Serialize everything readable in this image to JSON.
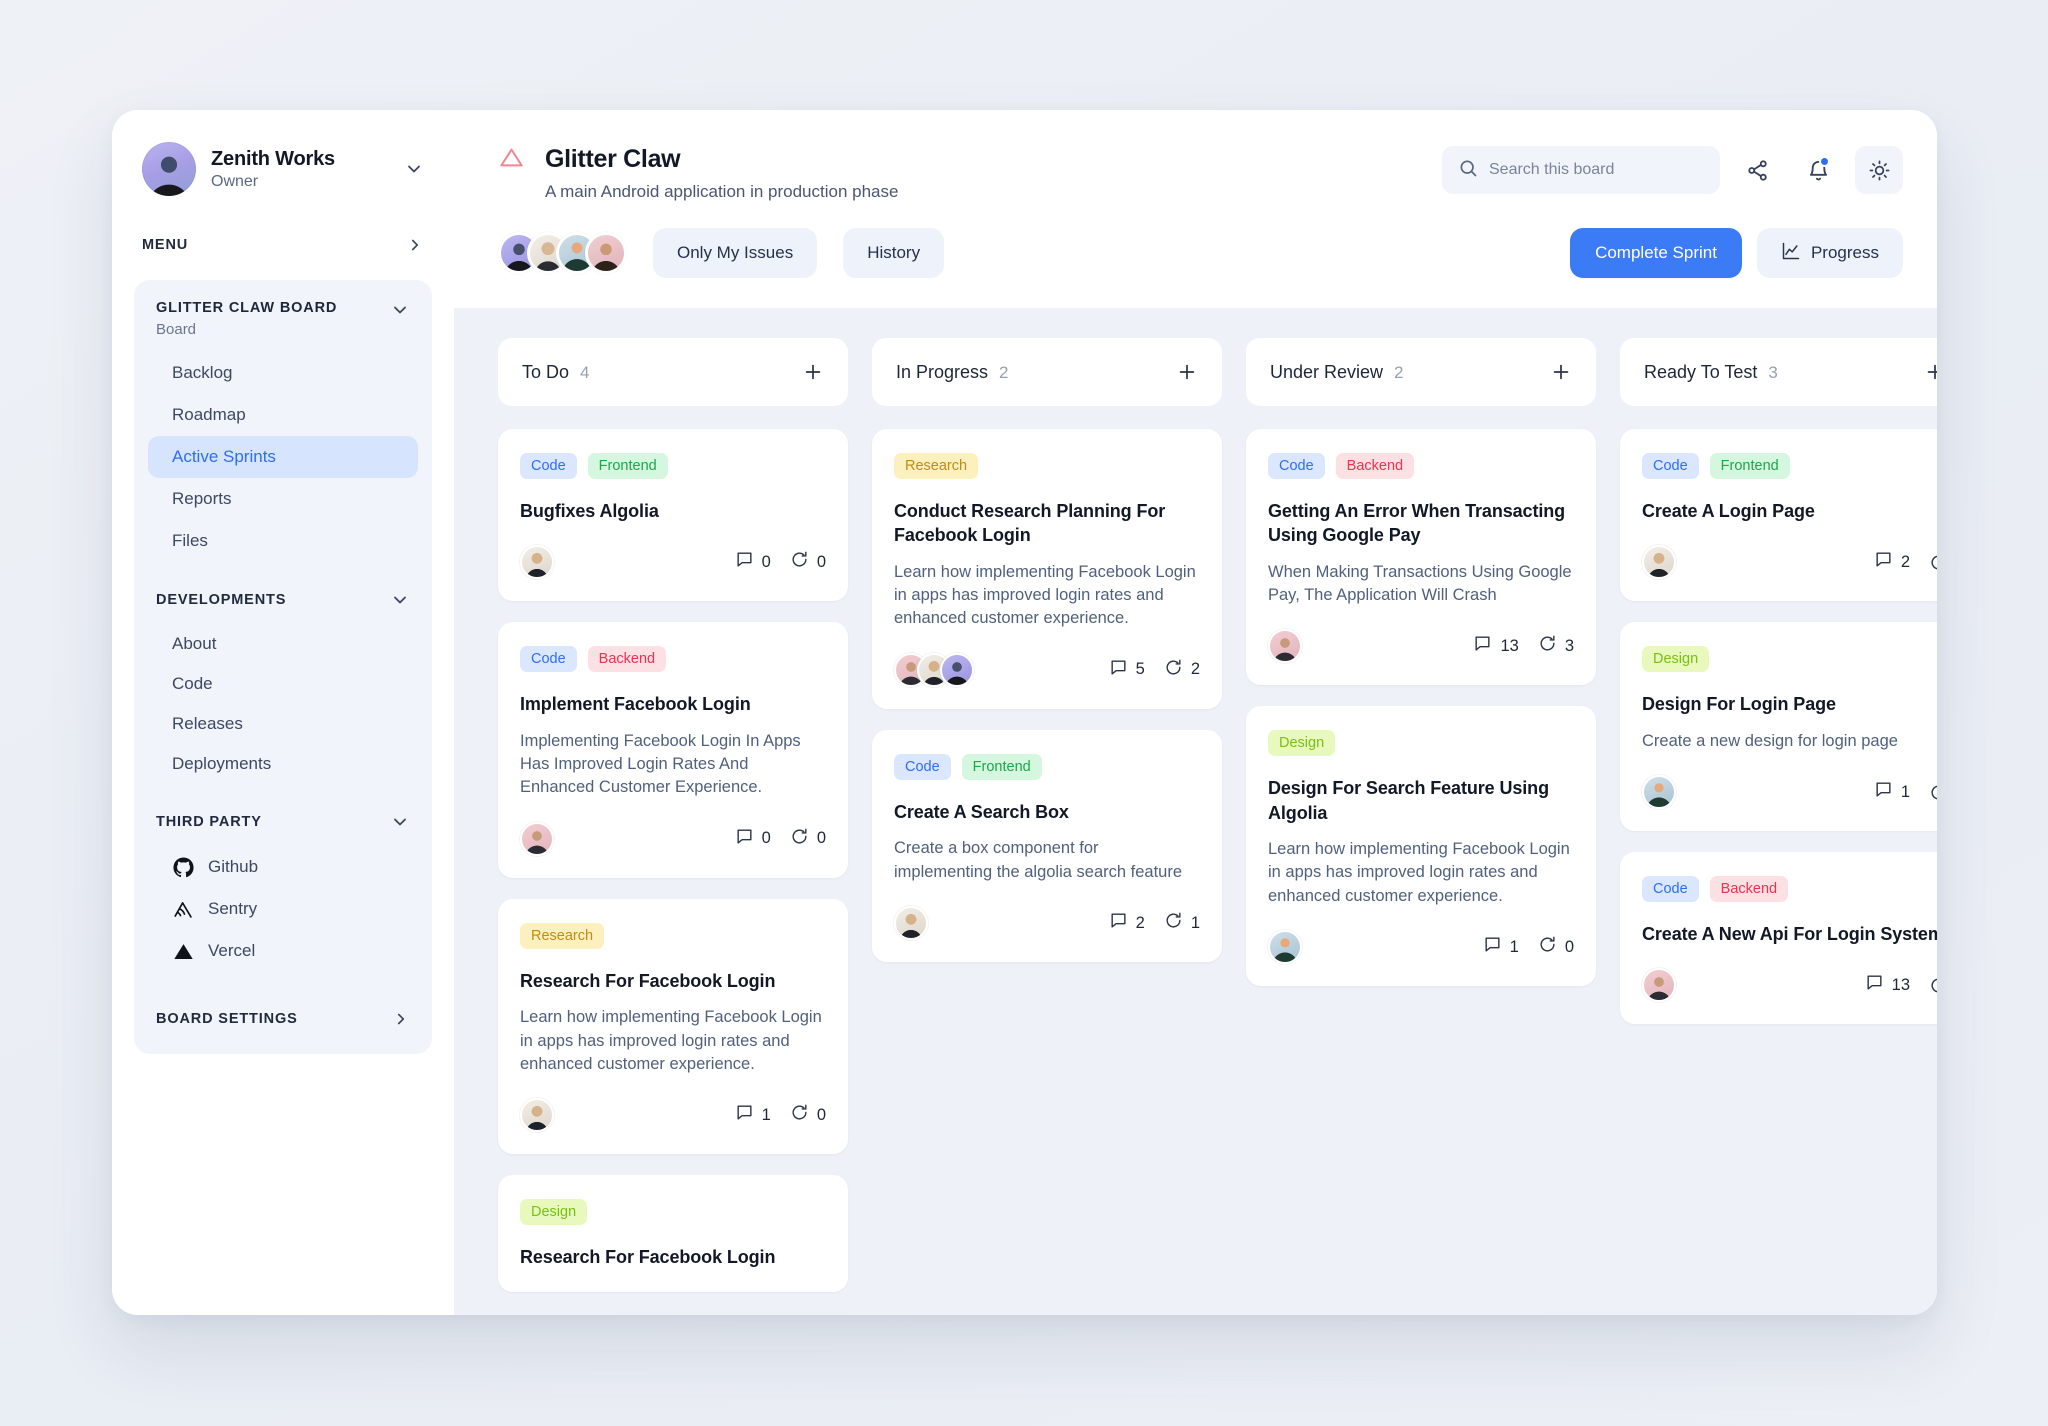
{
  "sidebar": {
    "org": {
      "name": "Zenith Works",
      "role": "Owner"
    },
    "menu_label": "MENU",
    "board": {
      "title": "GLITTER CLAW BOARD",
      "subtitle": "Board",
      "items": [
        {
          "label": "Backlog",
          "active": false
        },
        {
          "label": "Roadmap",
          "active": false
        },
        {
          "label": "Active Sprints",
          "active": true
        },
        {
          "label": "Reports",
          "active": false
        },
        {
          "label": "Files",
          "active": false
        }
      ]
    },
    "developments": {
      "title": "DEVELOPMENTS",
      "items": [
        {
          "label": "About"
        },
        {
          "label": "Code"
        },
        {
          "label": "Releases"
        },
        {
          "label": "Deployments"
        }
      ]
    },
    "third_party": {
      "title": "THIRD PARTY",
      "items": [
        {
          "label": "Github",
          "icon": "github-icon"
        },
        {
          "label": "Sentry",
          "icon": "sentry-icon"
        },
        {
          "label": "Vercel",
          "icon": "vercel-icon"
        }
      ]
    },
    "board_settings_label": "BOARD SETTINGS"
  },
  "header": {
    "project_name": "Glitter Claw",
    "project_desc": "A main Android application in production phase",
    "search_placeholder": "Search this board",
    "search_value": "",
    "icons": {
      "share": "share-icon",
      "notifications": "bell-icon",
      "theme": "sun-icon"
    }
  },
  "toolbar": {
    "only_my_issues": "Only My Issues",
    "history": "History",
    "complete_sprint": "Complete Sprint",
    "progress": "Progress"
  },
  "colors": {
    "accent": "#3b7bf5",
    "tag_code": "#2f6ef0",
    "tag_frontend": "#1aa84a",
    "tag_backend": "#f1304f",
    "tag_research": "#c08c12",
    "tag_design": "#76c214"
  },
  "board": {
    "columns": [
      {
        "title": "To Do",
        "count": "4",
        "cards": [
          {
            "tags": [
              {
                "label": "Code",
                "cls": "t-code"
              },
              {
                "label": "Frontend",
                "cls": "t-frontend"
              }
            ],
            "title": "Bugfixes Algolia",
            "desc": "",
            "avatars": [
              "fa1"
            ],
            "comments": "0",
            "updates": "0"
          },
          {
            "tags": [
              {
                "label": "Code",
                "cls": "t-code"
              },
              {
                "label": "Backend",
                "cls": "t-backend"
              }
            ],
            "title": "Implement Facebook Login",
            "desc": "Implementing Facebook Login In Apps Has Improved Login Rates And Enhanced Customer Experience.",
            "avatars": [
              "fa2"
            ],
            "comments": "0",
            "updates": "0"
          },
          {
            "tags": [
              {
                "label": "Research",
                "cls": "t-research"
              }
            ],
            "title": "Research For Facebook Login",
            "desc": "Learn how implementing Facebook Login in apps has improved login rates and enhanced customer experience.",
            "avatars": [
              "fa1"
            ],
            "comments": "1",
            "updates": "0"
          },
          {
            "tags": [
              {
                "label": "Design",
                "cls": "t-design"
              }
            ],
            "title": "Research For Facebook Login",
            "desc": "",
            "avatars": [],
            "comments": "",
            "updates": ""
          }
        ]
      },
      {
        "title": "In Progress",
        "count": "2",
        "cards": [
          {
            "tags": [
              {
                "label": "Research",
                "cls": "t-research"
              }
            ],
            "title": "Conduct Research Planning For Facebook Login",
            "desc": "Learn how implementing Facebook Login in apps has improved login rates and enhanced customer experience.",
            "avatars": [
              "fa2",
              "fa1",
              "fa4"
            ],
            "comments": "5",
            "updates": "2"
          },
          {
            "tags": [
              {
                "label": "Code",
                "cls": "t-code"
              },
              {
                "label": "Frontend",
                "cls": "t-frontend"
              }
            ],
            "title": "Create A Search Box",
            "desc": "Create a box component for implementing the algolia search feature",
            "avatars": [
              "fa1"
            ],
            "comments": "2",
            "updates": "1"
          }
        ]
      },
      {
        "title": "Under Review",
        "count": "2",
        "cards": [
          {
            "tags": [
              {
                "label": "Code",
                "cls": "t-code"
              },
              {
                "label": "Backend",
                "cls": "t-backend"
              }
            ],
            "title": "Getting An Error When Transacting Using Google Pay",
            "desc": "When Making Transactions Using Google Pay, The Application Will Crash",
            "avatars": [
              "fa2"
            ],
            "comments": "13",
            "updates": "3"
          },
          {
            "tags": [
              {
                "label": "Design",
                "cls": "t-design"
              }
            ],
            "title": "Design For Search Feature Using Algolia",
            "desc": "Learn how implementing Facebook Login in apps has improved login rates and enhanced customer experience.",
            "avatars": [
              "fa3"
            ],
            "comments": "1",
            "updates": "0"
          }
        ]
      },
      {
        "title": "Ready To Test",
        "count": "3",
        "cards": [
          {
            "tags": [
              {
                "label": "Code",
                "cls": "t-code"
              },
              {
                "label": "Frontend",
                "cls": "t-frontend"
              }
            ],
            "title": "Create A Login Page",
            "desc": "",
            "avatars": [
              "fa1"
            ],
            "comments": "2",
            "updates": ""
          },
          {
            "tags": [
              {
                "label": "Design",
                "cls": "t-design"
              }
            ],
            "title": "Design For Login Page",
            "desc": "Create a new design for login page",
            "avatars": [
              "fa3"
            ],
            "comments": "1",
            "updates": ""
          },
          {
            "tags": [
              {
                "label": "Code",
                "cls": "t-code"
              },
              {
                "label": "Backend",
                "cls": "t-backend"
              }
            ],
            "title": "Create A New Api For Login System",
            "desc": "",
            "avatars": [
              "fa2"
            ],
            "comments": "13",
            "updates": ""
          }
        ]
      }
    ]
  }
}
